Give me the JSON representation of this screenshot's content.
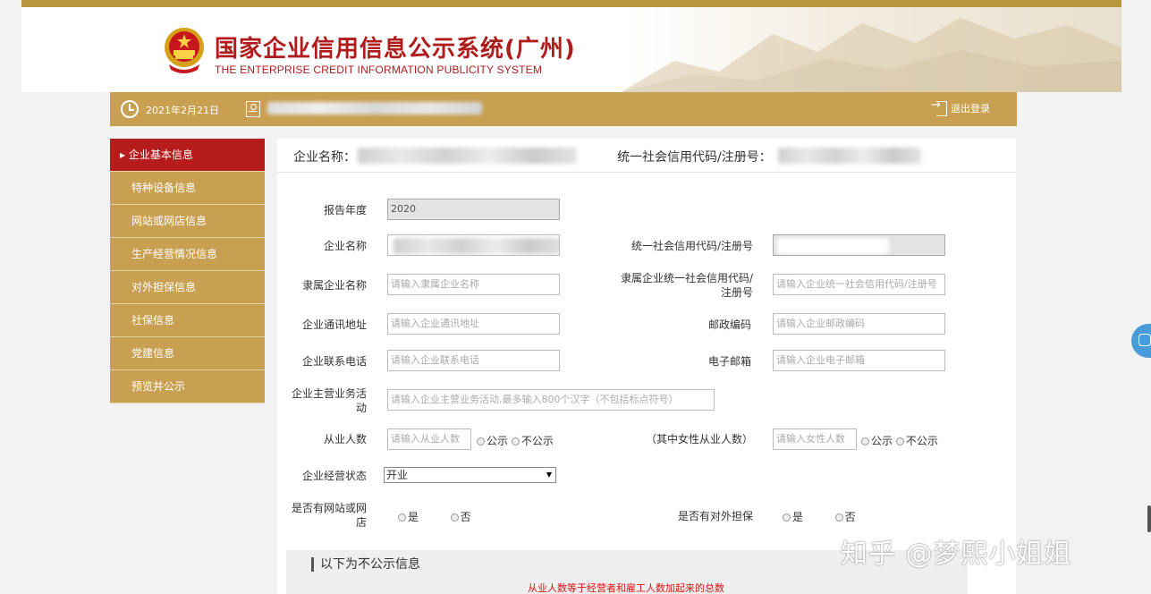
{
  "header": {
    "title": "国家企业信用信息公示系统(广州)",
    "subtitle": "THE ENTERPRISE CREDIT INFORMATION PUBLICITY SYSTEM"
  },
  "topbar": {
    "date": "2021年2月21日",
    "logout_label": "退出登录"
  },
  "sidebar": {
    "items": [
      {
        "label": "▸ 企业基本信息"
      },
      {
        "label": "特种设备信息"
      },
      {
        "label": "网站或网店信息"
      },
      {
        "label": "生产经营情况信息"
      },
      {
        "label": "对外担保信息"
      },
      {
        "label": "社保信息"
      },
      {
        "label": "党建信息"
      },
      {
        "label": "预览并公示"
      }
    ]
  },
  "main_header": {
    "company_label": "企业名称：",
    "credit_label": "统一社会信用代码/注册号："
  },
  "form": {
    "report_year": {
      "label": "报告年度",
      "value": "2020"
    },
    "company_name": {
      "label": "企业名称"
    },
    "credit_code": {
      "label": "统一社会信用代码/注册号"
    },
    "parent_name": {
      "label": "隶属企业名称",
      "placeholder": "请输入隶属企业名称"
    },
    "parent_code": {
      "label": "隶属企业统一社会信用代码/注册号",
      "placeholder": "请输入企业统一社会信用代码/注册号"
    },
    "address": {
      "label": "企业通讯地址",
      "placeholder": "请输入企业通讯地址"
    },
    "postcode": {
      "label": "邮政编码",
      "placeholder": "请输入企业邮政编码"
    },
    "phone": {
      "label": "企业联系电话",
      "placeholder": "请输入企业联系电话"
    },
    "email": {
      "label": "电子邮箱",
      "placeholder": "请输入企业电子邮箱"
    },
    "business": {
      "label": "企业主营业务活动",
      "placeholder": "请输入企业主营业务活动,最多输入800个汉字（不包括标点符号）"
    },
    "employees": {
      "label": "从业人数",
      "placeholder": "请输入从业人数"
    },
    "female_employees": {
      "label": "（其中女性从业人数）",
      "placeholder": "请输入女性人数"
    },
    "public_option": "公示",
    "nonpublic_option": "不公示",
    "status": {
      "label": "企业经营状态",
      "value": "开业"
    },
    "has_website": {
      "label": "是否有网站或网店"
    },
    "has_guarantee": {
      "label": "是否有对外担保"
    },
    "yes": "是",
    "no": "否"
  },
  "nonpublic": {
    "title": "以下为不公示信息",
    "note": "从业人数等于经营者和雇工人数加起来的总数"
  },
  "watermark": "知乎 @梦熙小姐姐",
  "colors": {
    "accent_gold": "#c9a052",
    "active_red": "#b71c1c",
    "title_red": "#b01c1c"
  }
}
